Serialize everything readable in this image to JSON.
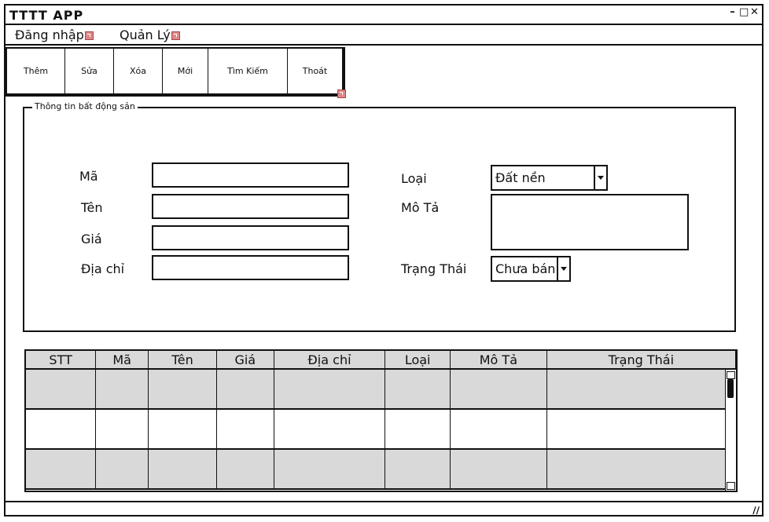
{
  "window": {
    "title": "TTTT APP"
  },
  "menu": [
    {
      "label": "Đăng nhập"
    },
    {
      "label": "Quản Lý"
    }
  ],
  "toolbar": [
    {
      "label": "Thêm"
    },
    {
      "label": "Sửa"
    },
    {
      "label": "Xóa"
    },
    {
      "label": "Mới"
    },
    {
      "label": "Tìm Kiếm"
    },
    {
      "label": "Thoát"
    }
  ],
  "form": {
    "legend": "Thông tin bất động sản",
    "labels": {
      "ma": "Mã",
      "ten": "Tên",
      "gia": "Giá",
      "diachi": "Địa chỉ",
      "loai": "Loại",
      "mota": "Mô Tả",
      "trangthai": "Trạng Thái"
    },
    "values": {
      "ma": "",
      "ten": "",
      "gia": "",
      "diachi": "",
      "mota": ""
    },
    "loai_selected": "Đất nền",
    "trangthai_selected": "Chưa bán"
  },
  "table": {
    "columns": [
      "STT",
      "Mã",
      "Tên",
      "Giá",
      "Địa chỉ",
      "Loại",
      "Mô Tả",
      "Trạng Thái"
    ],
    "rows": [
      [
        "",
        "",
        "",
        "",
        "",
        "",
        "",
        ""
      ],
      [
        "",
        "",
        "",
        "",
        "",
        "",
        "",
        ""
      ],
      [
        "",
        "",
        "",
        "",
        "",
        "",
        "",
        ""
      ]
    ]
  },
  "icons": {
    "minimize": "minimize-icon",
    "restore": "restore-icon",
    "close": "close-icon",
    "resize_grip": "resize-grip-icon"
  }
}
